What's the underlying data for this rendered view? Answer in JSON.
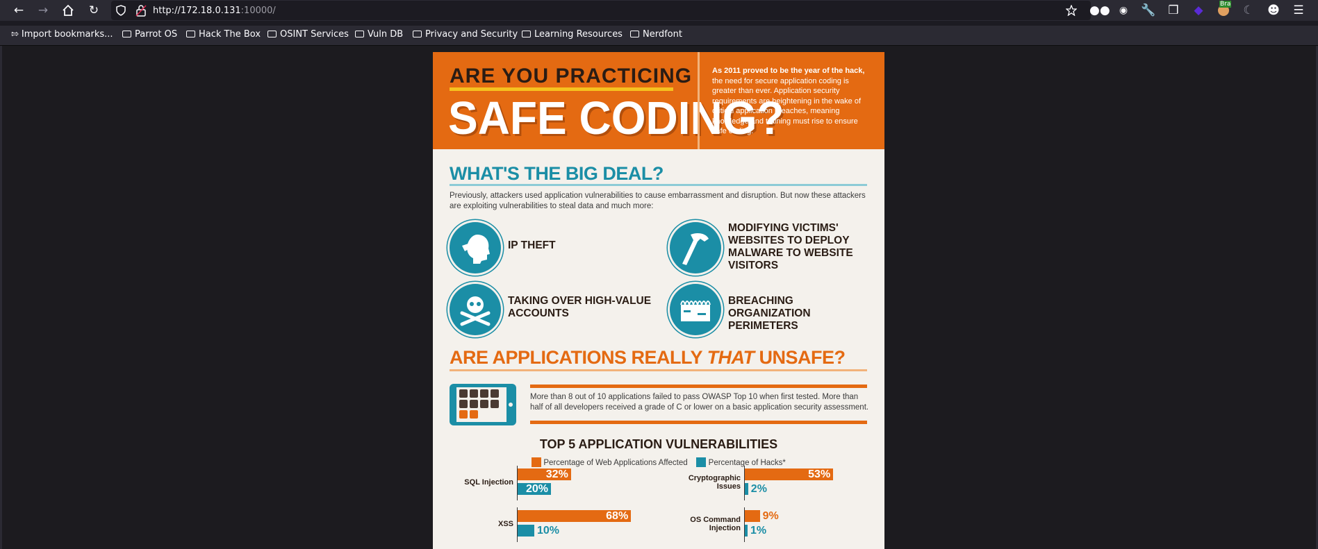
{
  "browser": {
    "url_host": "http://172.18.0.131",
    "url_port": ":10000/",
    "bookmarks": [
      "Import bookmarks...",
      "Parrot OS",
      "Hack The Box",
      "OSINT Services",
      "Vuln DB",
      "Privacy and Security",
      "Learning Resources",
      "Nerdfont"
    ],
    "ext_badge": "Bra"
  },
  "page": {
    "header_line1": "ARE YOU PRACTICING",
    "header_line2": "SAFE CODING?",
    "header_intro_bold": "As 2011 proved to be the year of the hack,",
    "header_intro_rest": "the need for secure application coding is greater than ever. Application security requirements are heightening in the wake of critical application breaches, meaning knowledge and training must rise to ensure safe coding.",
    "section1_title": "WHAT'S THE BIG DEAL?",
    "section1_text": "Previously, attackers used application vulnerabilities to cause embarrassment and disruption. But now these attackers are exploiting vulnerabilities to steal data and much more:",
    "threats": [
      {
        "label": "IP THEFT"
      },
      {
        "label": "MODIFYING VICTIMS' WEBSITES TO DEPLOY MALWARE TO WEBSITE VISITORS"
      },
      {
        "label": "TAKING OVER HIGH-VALUE ACCOUNTS"
      },
      {
        "label": "BREACHING ORGANIZATION PERIMETERS"
      }
    ],
    "section2_title_a": "ARE APPLICATIONS REALLY ",
    "section2_title_em": "THAT",
    "section2_title_b": " UNSAFE?",
    "section2_text": "More than 8 out of 10 applications failed to pass OWASP Top 10 when first tested. More than half of all developers received a grade of C or lower on a basic application security assessment.",
    "chart_title": "TOP 5 APPLICATION VULNERABILITIES"
  },
  "chart_data": {
    "type": "bar",
    "title": "TOP 5 APPLICATION VULNERABILITIES",
    "legend": "top-center",
    "series": [
      {
        "name": "Percentage of Web Applications Affected",
        "color": "#e46a12"
      },
      {
        "name": "Percentage of Hacks*",
        "color": "#1b8ea6"
      }
    ],
    "bars": [
      {
        "category": "SQL Injection",
        "apps": 32,
        "apps_label": "32%",
        "hacks": 20,
        "hacks_label": "20%"
      },
      {
        "category": "Cryptographic Issues",
        "apps": 53,
        "apps_label": "53%",
        "hacks": 2,
        "hacks_label": "2%"
      },
      {
        "category": "XSS",
        "apps": 68,
        "apps_label": "68%",
        "hacks": 10,
        "hacks_label": "10%"
      },
      {
        "category": "OS Command Injection",
        "apps": 9,
        "apps_label": "9%",
        "hacks": 1,
        "hacks_label": "1%"
      }
    ]
  }
}
